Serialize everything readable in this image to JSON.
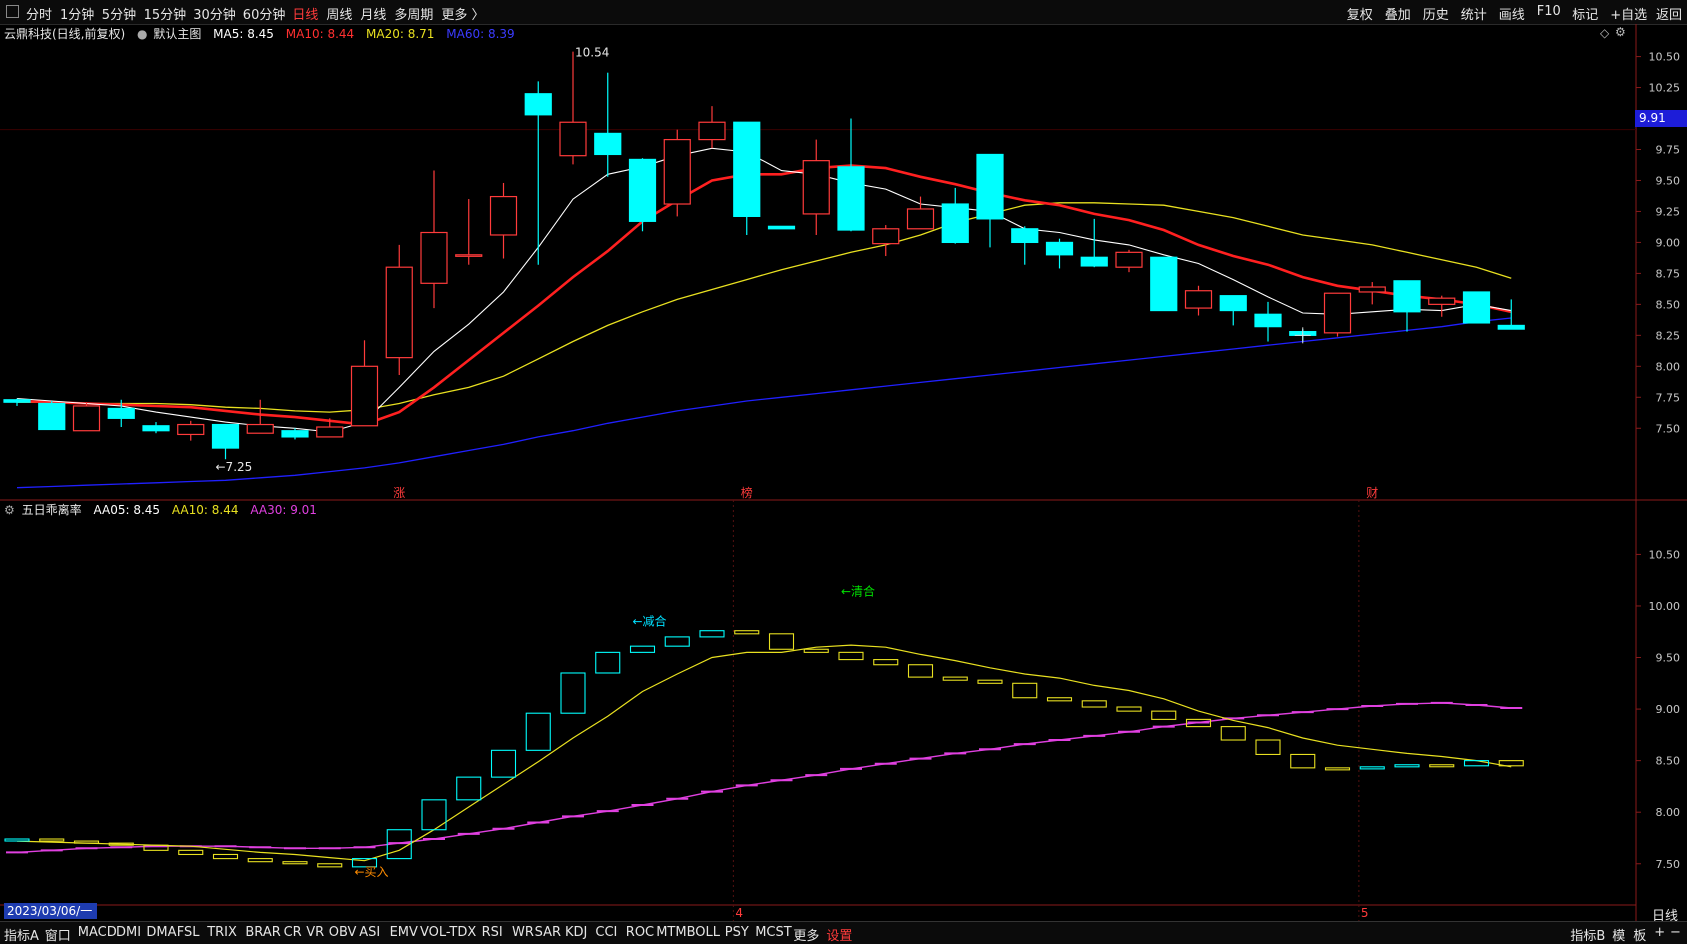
{
  "toolbar": {
    "left": [
      "分时",
      "1分钟",
      "5分钟",
      "15分钟",
      "30分钟",
      "60分钟",
      "日线",
      "周线",
      "月线",
      "多周期",
      "更多 〉"
    ],
    "active": "日线",
    "right": [
      "复权",
      "叠加",
      "历史",
      "统计",
      "画线",
      "F10",
      "标记",
      "+自选",
      "返回"
    ]
  },
  "main_legend": {
    "stock": "云鼎科技(日线,前复权)",
    "template": "默认主图",
    "ma5": "MA5: 8.45",
    "ma10": "MA10: 8.44",
    "ma20": "MA20: 8.71",
    "ma60": "MA60: 8.39"
  },
  "sub_legend": {
    "name": "五日乖离率",
    "aa05": "AA05: 8.45",
    "aa10": "AA10: 8.44",
    "aa30": "AA30: 9.01"
  },
  "colors": {
    "up": "#ff3b3b",
    "down": "#00ffff",
    "ma5": "#ffffff",
    "ma10": "#ff2020",
    "ma20": "#e8e020",
    "ma60": "#2020ff",
    "aa30": "#e040e0",
    "signal_buy": "#ff8c00",
    "signal_reduce": "#00e0ff",
    "signal_clear": "#00e000"
  },
  "current_price": "9.91",
  "date_label": "2023/03/06/一",
  "month_marks": [
    "4",
    "5"
  ],
  "period_label": "日线",
  "chart_data": [
    {
      "type": "candlestick",
      "title": "云鼎科技(日线,前复权)",
      "ylim": [
        7.05,
        10.65
      ],
      "yticks": [
        "10.50",
        "10.25",
        "10.00",
        "9.75",
        "9.50",
        "9.25",
        "9.00",
        "8.75",
        "8.50",
        "8.25",
        "8.00",
        "7.75",
        "7.50"
      ],
      "candles": [
        {
          "o": 7.73,
          "h": 7.74,
          "l": 7.68,
          "c": 7.71
        },
        {
          "o": 7.7,
          "h": 7.72,
          "l": 7.49,
          "c": 7.49
        },
        {
          "o": 7.48,
          "h": 7.71,
          "l": 7.48,
          "c": 7.68
        },
        {
          "o": 7.66,
          "h": 7.73,
          "l": 7.51,
          "c": 7.58
        },
        {
          "o": 7.52,
          "h": 7.55,
          "l": 7.46,
          "c": 7.48
        },
        {
          "o": 7.45,
          "h": 7.56,
          "l": 7.4,
          "c": 7.53
        },
        {
          "o": 7.53,
          "h": 7.53,
          "l": 7.25,
          "c": 7.34
        },
        {
          "o": 7.46,
          "h": 7.73,
          "l": 7.46,
          "c": 7.53
        },
        {
          "o": 7.48,
          "h": 7.5,
          "l": 7.41,
          "c": 7.43
        },
        {
          "o": 7.43,
          "h": 7.58,
          "l": 7.43,
          "c": 7.51
        },
        {
          "o": 7.52,
          "h": 8.21,
          "l": 7.52,
          "c": 8.0
        },
        {
          "o": 8.07,
          "h": 8.98,
          "l": 7.93,
          "c": 8.8
        },
        {
          "o": 8.67,
          "h": 9.58,
          "l": 8.47,
          "c": 9.08
        },
        {
          "o": 8.89,
          "h": 9.35,
          "l": 8.82,
          "c": 8.9
        },
        {
          "o": 9.06,
          "h": 9.48,
          "l": 8.87,
          "c": 9.37
        },
        {
          "o": 10.2,
          "h": 10.3,
          "l": 8.82,
          "c": 10.03
        },
        {
          "o": 9.7,
          "h": 10.54,
          "l": 9.63,
          "c": 9.97
        },
        {
          "o": 9.88,
          "h": 10.37,
          "l": 9.53,
          "c": 9.71
        },
        {
          "o": 9.67,
          "h": 9.68,
          "l": 9.09,
          "c": 9.17
        },
        {
          "o": 9.31,
          "h": 9.91,
          "l": 9.21,
          "c": 9.83
        },
        {
          "o": 9.83,
          "h": 10.1,
          "l": 9.76,
          "c": 9.97
        },
        {
          "o": 9.97,
          "h": 9.97,
          "l": 9.06,
          "c": 9.21
        },
        {
          "o": 9.13,
          "h": 9.13,
          "l": 9.11,
          "c": 9.11
        },
        {
          "o": 9.23,
          "h": 9.83,
          "l": 9.06,
          "c": 9.66
        },
        {
          "o": 9.61,
          "h": 10.0,
          "l": 9.09,
          "c": 9.1
        },
        {
          "o": 8.99,
          "h": 9.14,
          "l": 8.89,
          "c": 9.11
        },
        {
          "o": 9.11,
          "h": 9.37,
          "l": 9.11,
          "c": 9.27
        },
        {
          "o": 9.31,
          "h": 9.44,
          "l": 8.99,
          "c": 9.0
        },
        {
          "o": 9.71,
          "h": 9.71,
          "l": 8.96,
          "c": 9.19
        },
        {
          "o": 9.11,
          "h": 9.13,
          "l": 8.82,
          "c": 9.0
        },
        {
          "o": 9.0,
          "h": 9.03,
          "l": 8.79,
          "c": 8.9
        },
        {
          "o": 8.88,
          "h": 9.19,
          "l": 8.8,
          "c": 8.81
        },
        {
          "o": 8.8,
          "h": 8.94,
          "l": 8.76,
          "c": 8.92
        },
        {
          "o": 8.88,
          "h": 8.88,
          "l": 8.45,
          "c": 8.45
        },
        {
          "o": 8.47,
          "h": 8.65,
          "l": 8.41,
          "c": 8.61
        },
        {
          "o": 8.57,
          "h": 8.57,
          "l": 8.33,
          "c": 8.45
        },
        {
          "o": 8.42,
          "h": 8.52,
          "l": 8.2,
          "c": 8.32
        },
        {
          "o": 8.28,
          "h": 8.3,
          "l": 8.2,
          "c": 8.25
        },
        {
          "o": 8.27,
          "h": 8.59,
          "l": 8.24,
          "c": 8.59
        },
        {
          "o": 8.6,
          "h": 8.68,
          "l": 8.5,
          "c": 8.64
        },
        {
          "o": 8.69,
          "h": 8.69,
          "l": 8.28,
          "c": 8.44
        },
        {
          "o": 8.5,
          "h": 8.57,
          "l": 8.4,
          "c": 8.55
        },
        {
          "o": 8.6,
          "h": 8.6,
          "l": 8.35,
          "c": 8.35
        },
        {
          "o": 8.33,
          "h": 8.54,
          "l": 8.3,
          "c": 8.3
        }
      ],
      "ma5": [
        7.74,
        7.72,
        7.7,
        7.68,
        7.63,
        7.59,
        7.55,
        7.52,
        7.5,
        7.47,
        7.55,
        7.83,
        8.12,
        8.34,
        8.6,
        8.96,
        9.35,
        9.55,
        9.61,
        9.7,
        9.76,
        9.73,
        9.58,
        9.55,
        9.48,
        9.43,
        9.31,
        9.28,
        9.25,
        9.11,
        9.08,
        9.02,
        8.98,
        8.9,
        8.83,
        8.7,
        8.56,
        8.43,
        8.42,
        8.44,
        8.46,
        8.45,
        8.5,
        8.45
      ],
      "ma10": [
        7.72,
        7.71,
        7.7,
        7.69,
        7.68,
        7.67,
        7.64,
        7.61,
        7.59,
        7.56,
        7.53,
        7.63,
        7.83,
        8.05,
        8.27,
        8.49,
        8.72,
        8.93,
        9.17,
        9.34,
        9.5,
        9.55,
        9.55,
        9.6,
        9.62,
        9.6,
        9.53,
        9.47,
        9.4,
        9.34,
        9.3,
        9.23,
        9.18,
        9.1,
        8.98,
        8.89,
        8.82,
        8.72,
        8.65,
        8.61,
        8.57,
        8.54,
        8.5,
        8.44
      ],
      "ma20": [
        7.71,
        7.71,
        7.7,
        7.7,
        7.7,
        7.69,
        7.67,
        7.66,
        7.64,
        7.63,
        7.65,
        7.7,
        7.77,
        7.83,
        7.92,
        8.06,
        8.2,
        8.33,
        8.44,
        8.54,
        8.62,
        8.7,
        8.78,
        8.85,
        8.92,
        8.98,
        9.06,
        9.16,
        9.23,
        9.3,
        9.32,
        9.32,
        9.31,
        9.3,
        9.25,
        9.2,
        9.13,
        9.06,
        9.02,
        8.98,
        8.92,
        8.86,
        8.8,
        8.71
      ],
      "ma60": [
        7.02,
        7.03,
        7.04,
        7.05,
        7.06,
        7.07,
        7.08,
        7.1,
        7.12,
        7.15,
        7.18,
        7.22,
        7.27,
        7.32,
        7.37,
        7.43,
        7.48,
        7.54,
        7.59,
        7.64,
        7.68,
        7.72,
        7.75,
        7.78,
        7.81,
        7.84,
        7.87,
        7.9,
        7.93,
        7.96,
        7.99,
        8.02,
        8.05,
        8.08,
        8.11,
        8.14,
        8.17,
        8.2,
        8.23,
        8.26,
        8.29,
        8.32,
        8.36,
        8.39
      ],
      "annotations": [
        {
          "text": "10.54",
          "index": 16,
          "value": 10.54
        },
        {
          "text": "←7.25",
          "index": 6,
          "value": 7.25
        }
      ],
      "event_marks": [
        {
          "text": "涨",
          "index": 11
        },
        {
          "text": "榜",
          "index": 21
        },
        {
          "text": "财",
          "index": 39
        }
      ]
    },
    {
      "type": "candlestick-indicator",
      "title": "五日乖离率",
      "ylim": [
        7.1,
        10.95
      ],
      "yticks": [
        "10.50",
        "10.00",
        "9.50",
        "9.00",
        "8.50",
        "8.00",
        "7.50"
      ],
      "series": [
        {
          "name": "AA05",
          "values": [
            7.74,
            7.72,
            7.7,
            7.68,
            7.63,
            7.59,
            7.55,
            7.52,
            7.5,
            7.47,
            7.55,
            7.83,
            8.12,
            8.34,
            8.6,
            8.96,
            9.35,
            9.55,
            9.61,
            9.7,
            9.76,
            9.73,
            9.58,
            9.55,
            9.48,
            9.43,
            9.31,
            9.28,
            9.25,
            9.11,
            9.08,
            9.02,
            8.98,
            8.9,
            8.83,
            8.7,
            8.56,
            8.43,
            8.42,
            8.44,
            8.46,
            8.45,
            8.5,
            8.45
          ]
        },
        {
          "name": "AA10",
          "values": [
            7.72,
            7.71,
            7.7,
            7.69,
            7.68,
            7.67,
            7.64,
            7.61,
            7.59,
            7.56,
            7.53,
            7.63,
            7.83,
            8.05,
            8.27,
            8.49,
            8.72,
            8.93,
            9.17,
            9.34,
            9.5,
            9.55,
            9.55,
            9.6,
            9.62,
            9.6,
            9.53,
            9.47,
            9.4,
            9.34,
            9.3,
            9.23,
            9.18,
            9.1,
            8.98,
            8.89,
            8.82,
            8.72,
            8.65,
            8.61,
            8.57,
            8.54,
            8.5,
            8.44
          ]
        },
        {
          "name": "AA30",
          "values": [
            7.61,
            7.63,
            7.65,
            7.66,
            7.67,
            7.67,
            7.67,
            7.66,
            7.65,
            7.65,
            7.66,
            7.7,
            7.74,
            7.79,
            7.84,
            7.9,
            7.96,
            8.01,
            8.07,
            8.13,
            8.2,
            8.26,
            8.31,
            8.36,
            8.42,
            8.47,
            8.52,
            8.57,
            8.61,
            8.66,
            8.7,
            8.74,
            8.78,
            8.83,
            8.87,
            8.91,
            8.94,
            8.97,
            9.0,
            9.03,
            9.05,
            9.06,
            9.04,
            9.01
          ]
        }
      ],
      "signals": [
        {
          "text": "←买入",
          "index": 10,
          "value": 7.43
        },
        {
          "text": "←减合",
          "index": 18,
          "value": 9.86
        },
        {
          "text": "←清合",
          "index": 24,
          "value": 10.15
        }
      ]
    }
  ],
  "bottom_tabs": [
    "指标A",
    "窗口",
    "MACD",
    "DMI",
    "DMA",
    "FSL",
    "TRIX",
    "BRAR",
    "CR",
    "VR",
    "OBV",
    "ASI",
    "EMV",
    "VOL-TDX",
    "RSI",
    "WR",
    "SAR",
    "KDJ",
    "CCI",
    "ROC",
    "MTM",
    "BOLL",
    "PSY",
    "MCST",
    "更多",
    "设置"
  ],
  "bottom_right": [
    "指标B",
    "模",
    "板",
    "+",
    "−"
  ]
}
